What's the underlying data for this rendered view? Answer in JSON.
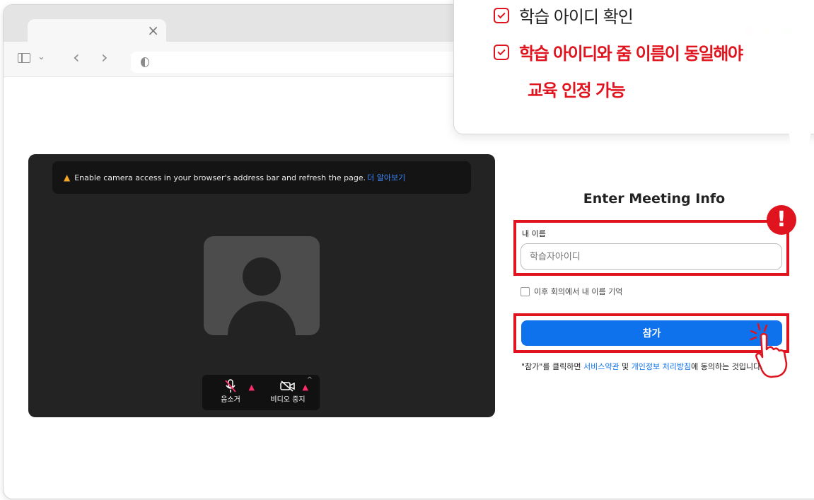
{
  "browser": {
    "tab_close": "×",
    "nav_back": "‹",
    "nav_forward": "›",
    "chevron": "⌄",
    "traffic_colors": [
      "#f2a7a4",
      "#f5dd8c",
      "#a5dfa7"
    ]
  },
  "callout": {
    "line1": "학습 아이디 확인",
    "line2": "학습 아이디와 줌 이름이 동일해야",
    "line3": "교육 인정 가능"
  },
  "preview": {
    "banner_text": "Enable camera access in your browser's address bar and refresh the page.",
    "banner_link": "더 알아보기",
    "mute_label": "음소거",
    "video_label": "비디오 중지"
  },
  "form": {
    "title": "Enter Meeting Info",
    "name_label": "내 이름",
    "name_placeholder": "학습자아이디",
    "name_value": "",
    "remember_label": "이후 회의에서 내 이름 기억",
    "join_label": "참가",
    "terms_prefix": "\"참가\"를 클릭하면 ",
    "terms_link1": "서비스약관",
    "terms_mid": " 및 ",
    "terms_link2": "개인정보 처리방침",
    "terms_suffix": "에 동의하는 것입니다.",
    "alert_mark": "!"
  },
  "colors": {
    "accent_red": "#e0141e",
    "join_blue": "#0e72ed",
    "preview_bg": "#232323"
  }
}
